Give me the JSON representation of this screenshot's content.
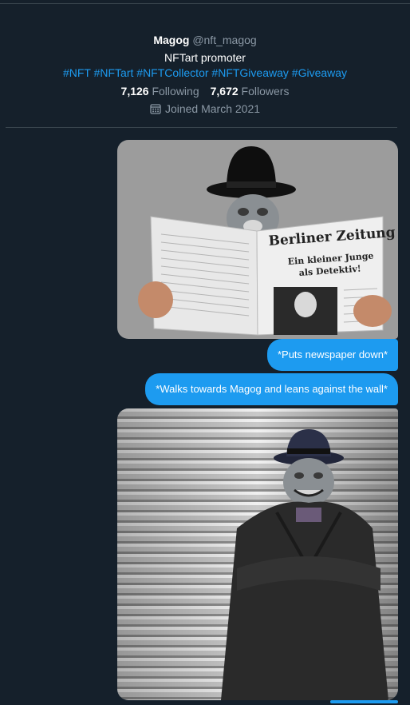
{
  "profile": {
    "display_name": "Magog",
    "handle": "@nft_magog",
    "bio": "NFTart promoter",
    "hashtags": [
      "#NFT",
      "#NFTart",
      "#NFTCollector",
      "#NFTGiveaway",
      "#Giveaway"
    ],
    "following_count": "7,126",
    "following_label": "Following",
    "followers_count": "7,672",
    "followers_label": "Followers",
    "joined": "Joined March 2021"
  },
  "messages": [
    {
      "type": "image",
      "alt_icon": "newspaper-reader-image",
      "newspaper_title": "Berliner Zeitung",
      "headline_line1": "Ein kleiner Junge",
      "headline_line2": "als Detektiv!"
    },
    {
      "type": "text",
      "text": "*Puts newspaper down*"
    },
    {
      "type": "text",
      "text": "*Walks towards Magog and leans against the wall*"
    },
    {
      "type": "image",
      "alt_icon": "trenchcoat-figure-image"
    }
  ],
  "colors": {
    "background": "#15202b",
    "accent": "#1d9bf0",
    "muted": "#8b98a5"
  }
}
